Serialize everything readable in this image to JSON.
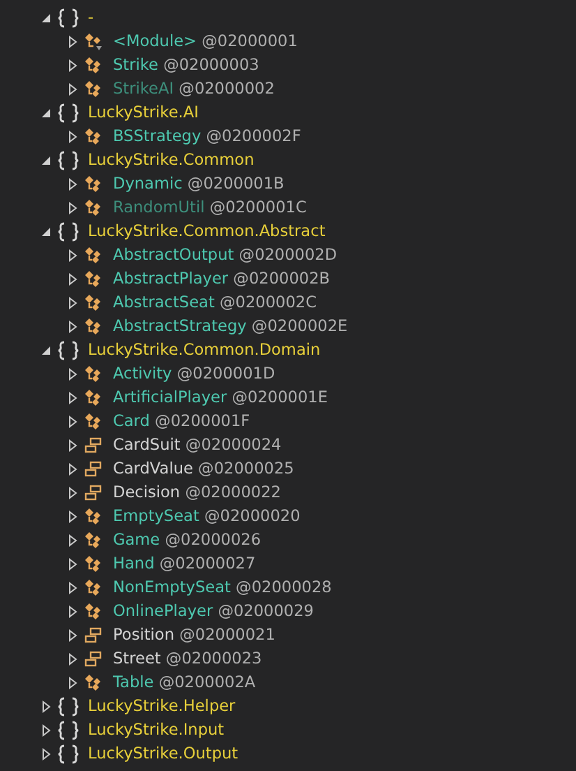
{
  "namespaces": [
    {
      "name": "-",
      "expanded": true,
      "children": [
        {
          "kind": "module",
          "name": "<Module>",
          "token": "@02000001",
          "expanded": false
        },
        {
          "kind": "class",
          "name": "Strike",
          "token": "@02000003",
          "expanded": false
        },
        {
          "kind": "static_class",
          "name": "StrikeAI",
          "token": "@02000002",
          "expanded": false
        }
      ]
    },
    {
      "name": "LuckyStrike.AI",
      "expanded": true,
      "children": [
        {
          "kind": "class",
          "name": "BSStrategy",
          "token": "@0200002F",
          "expanded": false
        }
      ]
    },
    {
      "name": "LuckyStrike.Common",
      "expanded": true,
      "children": [
        {
          "kind": "class",
          "name": "Dynamic",
          "token": "@0200001B",
          "expanded": false
        },
        {
          "kind": "static_class",
          "name": "RandomUtil",
          "token": "@0200001C",
          "expanded": false
        }
      ]
    },
    {
      "name": "LuckyStrike.Common.Abstract",
      "expanded": true,
      "children": [
        {
          "kind": "class",
          "name": "AbstractOutput",
          "token": "@0200002D",
          "expanded": false
        },
        {
          "kind": "class",
          "name": "AbstractPlayer",
          "token": "@0200002B",
          "expanded": false
        },
        {
          "kind": "class",
          "name": "AbstractSeat",
          "token": "@0200002C",
          "expanded": false
        },
        {
          "kind": "class",
          "name": "AbstractStrategy",
          "token": "@0200002E",
          "expanded": false
        }
      ]
    },
    {
      "name": "LuckyStrike.Common.Domain",
      "expanded": true,
      "children": [
        {
          "kind": "class",
          "name": "Activity",
          "token": "@0200001D",
          "expanded": false
        },
        {
          "kind": "class",
          "name": "ArtificialPlayer",
          "token": "@0200001E",
          "expanded": false
        },
        {
          "kind": "class",
          "name": "Card",
          "token": "@0200001F",
          "expanded": false
        },
        {
          "kind": "enum",
          "name": "CardSuit",
          "token": "@02000024",
          "expanded": false
        },
        {
          "kind": "enum",
          "name": "CardValue",
          "token": "@02000025",
          "expanded": false
        },
        {
          "kind": "enum",
          "name": "Decision",
          "token": "@02000022",
          "expanded": false
        },
        {
          "kind": "class",
          "name": "EmptySeat",
          "token": "@02000020",
          "expanded": false
        },
        {
          "kind": "class",
          "name": "Game",
          "token": "@02000026",
          "expanded": false
        },
        {
          "kind": "class",
          "name": "Hand",
          "token": "@02000027",
          "expanded": false
        },
        {
          "kind": "class",
          "name": "NonEmptySeat",
          "token": "@02000028",
          "expanded": false
        },
        {
          "kind": "class",
          "name": "OnlinePlayer",
          "token": "@02000029",
          "expanded": false
        },
        {
          "kind": "enum",
          "name": "Position",
          "token": "@02000021",
          "expanded": false
        },
        {
          "kind": "enum",
          "name": "Street",
          "token": "@02000023",
          "expanded": false
        },
        {
          "kind": "class",
          "name": "Table",
          "token": "@0200002A",
          "expanded": false
        }
      ]
    },
    {
      "name": "LuckyStrike.Helper",
      "expanded": false
    },
    {
      "name": "LuckyStrike.Input",
      "expanded": false
    },
    {
      "name": "LuckyStrike.Output",
      "expanded": false
    }
  ]
}
